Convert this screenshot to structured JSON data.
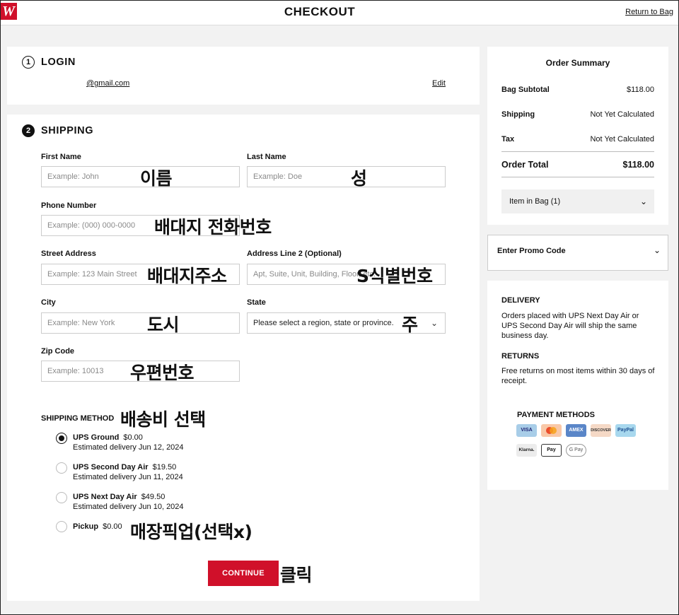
{
  "header": {
    "logo_text": "W",
    "title": "CHECKOUT",
    "return_label": "Return to Bag"
  },
  "login": {
    "step": "1",
    "title": "LOGIN",
    "email": "@gmail.com",
    "edit_label": "Edit"
  },
  "shipping": {
    "step": "2",
    "title": "SHIPPING",
    "first_name": {
      "label": "First Name",
      "placeholder": "Example: John",
      "annotation": "이름"
    },
    "last_name": {
      "label": "Last Name",
      "placeholder": "Example: Doe",
      "annotation": "성"
    },
    "phone": {
      "label": "Phone Number",
      "placeholder": "Example: (000) 000-0000",
      "annotation": "배대지 전화번호"
    },
    "street": {
      "label": "Street Address",
      "placeholder": "Example: 123 Main Street",
      "annotation": "배대지주소"
    },
    "address2": {
      "label": "Address Line 2 (Optional)",
      "placeholder": "Apt, Suite, Unit, Building, Floor, etc.",
      "annotation": "S식별번호"
    },
    "city": {
      "label": "City",
      "placeholder": "Example: New York",
      "annotation": "도시"
    },
    "state": {
      "label": "State",
      "value": "Please select a region, state or province.",
      "annotation": "주"
    },
    "zip": {
      "label": "Zip Code",
      "placeholder": "Example: 10013",
      "annotation": "우편번호"
    },
    "method_title": "SHIPPING METHOD",
    "method_annotation": "배송비 선택",
    "methods": [
      {
        "name": "UPS Ground",
        "price": "$0.00",
        "estimate": "Estimated delivery Jun 12, 2024",
        "selected": true
      },
      {
        "name": "UPS Second Day Air",
        "price": "$19.50",
        "estimate": "Estimated delivery Jun 11, 2024",
        "selected": false
      },
      {
        "name": "UPS Next Day Air",
        "price": "$49.50",
        "estimate": "Estimated delivery Jun 10, 2024",
        "selected": false
      },
      {
        "name": "Pickup",
        "price": "$0.00",
        "estimate": "",
        "selected": false,
        "annotation": "매장픽업(선택x)"
      }
    ],
    "continue_label": "CONTINUE",
    "continue_annotation": "클릭"
  },
  "summary": {
    "title": "Order Summary",
    "subtotal_label": "Bag Subtotal",
    "subtotal_value": "$118.00",
    "shipping_label": "Shipping",
    "shipping_value": "Not Yet Calculated",
    "tax_label": "Tax",
    "tax_value": "Not Yet Calculated",
    "total_label": "Order Total",
    "total_value": "$118.00",
    "bag_toggle": "Item in Bag (1)"
  },
  "promo": {
    "label": "Enter Promo Code"
  },
  "info": {
    "delivery_title": "DELIVERY",
    "delivery_text": "Orders placed with UPS Next Day Air or UPS Second Day Air will ship the same business day.",
    "returns_title": "RETURNS",
    "returns_text": "Free returns on most items within 30 days of receipt.",
    "payment_title": "PAYMENT METHODS",
    "payment_icons": [
      "VISA",
      "mastercard",
      "AMEX",
      "DISCOVER",
      "PayPal",
      "Klarna.",
      "Pay",
      "G Pay"
    ]
  },
  "colors": {
    "brand_red": "#d0102a"
  }
}
